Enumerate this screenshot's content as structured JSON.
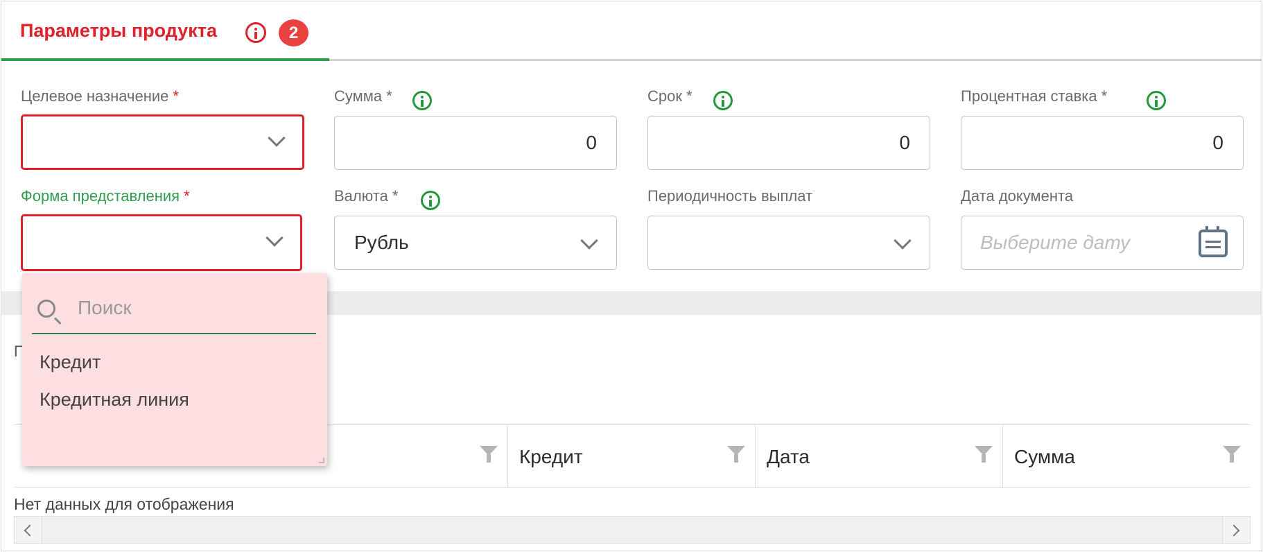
{
  "tab": {
    "label": "Параметры продукта",
    "badge": "2"
  },
  "form": {
    "purpose": {
      "label": "Целевое назначение",
      "required": "*",
      "value": ""
    },
    "amount": {
      "label": "Сумма",
      "required": "*",
      "value": "0"
    },
    "term": {
      "label": "Срок",
      "required": "*",
      "value": "0"
    },
    "rate": {
      "label": "Процентная ставка",
      "required": "*",
      "value": "0"
    },
    "form_type": {
      "label": "Форма представления",
      "required": "*",
      "value": ""
    },
    "currency": {
      "label": "Валюта",
      "required": "*",
      "value": "Рубль"
    },
    "periodicity": {
      "label": "Периодичность выплат",
      "value": ""
    },
    "doc_date": {
      "label": "Дата документа",
      "placeholder": "Выберите дату"
    }
  },
  "dropdown": {
    "search_placeholder": "Поиск",
    "options": [
      "Кредит",
      "Кредитная линия"
    ]
  },
  "grid": {
    "title_visible_fragment": "П",
    "columns": [
      "",
      "Кредит",
      "Дата",
      "Сумма"
    ],
    "empty_text": "Нет данных для отображения"
  },
  "colors": {
    "error": "#e0202b",
    "accent_green": "#2e9e4f",
    "badge": "#e94040",
    "dropdown_bg": "#fddfe1"
  }
}
